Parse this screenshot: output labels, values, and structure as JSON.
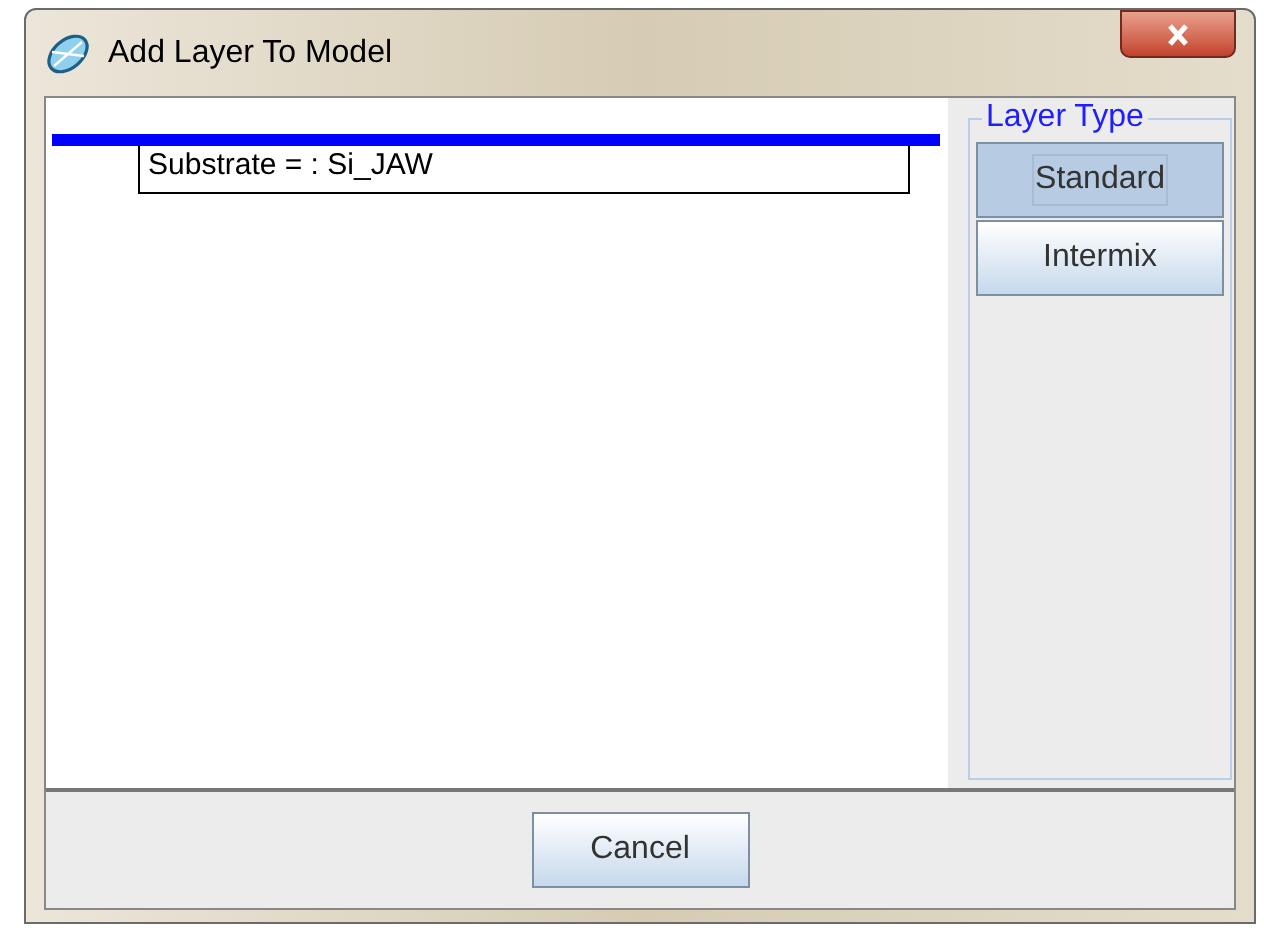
{
  "window": {
    "title": "Add Layer To Model"
  },
  "model": {
    "layers": [
      {
        "text": "Substrate = :  Si_JAW"
      }
    ]
  },
  "layer_type": {
    "title": "Layer Type",
    "options": [
      {
        "label": "Standard",
        "selected": true
      },
      {
        "label": "Intermix",
        "selected": false
      }
    ]
  },
  "buttons": [
    "Cancel"
  ]
}
